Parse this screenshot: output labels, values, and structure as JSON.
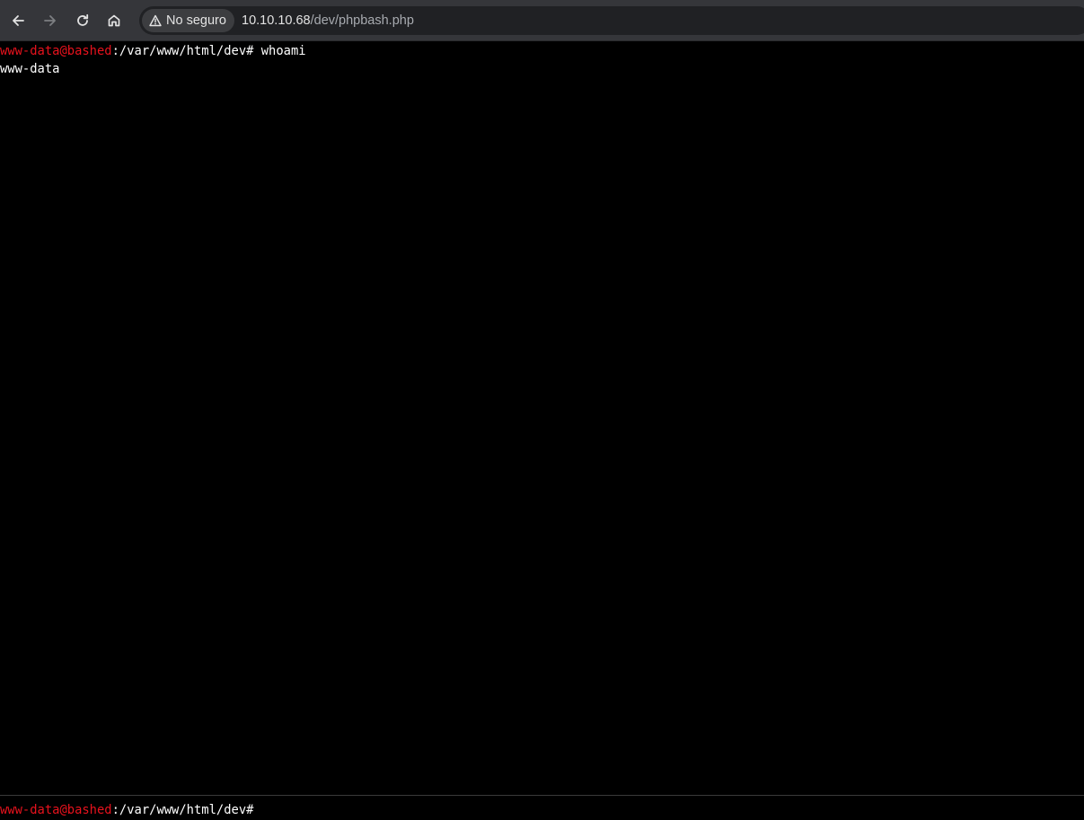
{
  "browser": {
    "security_label": "No seguro",
    "url_host": "10.10.10.68",
    "url_path": "/dev/phpbash.php",
    "icons": {
      "back": "arrow-left-icon",
      "forward": "arrow-right-icon",
      "reload": "reload-icon",
      "home": "home-icon",
      "security": "warning-triangle-icon"
    }
  },
  "terminal": {
    "entries": [
      {
        "prompt_user": "www-data@bashed",
        "prompt_path": ":/var/www/html/dev#",
        "command": " whoami",
        "output": "www-data"
      }
    ]
  },
  "input": {
    "prompt_user": "www-data@bashed",
    "prompt_path": ":/var/www/html/dev#",
    "value": ""
  },
  "colors": {
    "prompt_user": "#e8121d",
    "background": "#000000",
    "toolbar": "#35363a"
  }
}
